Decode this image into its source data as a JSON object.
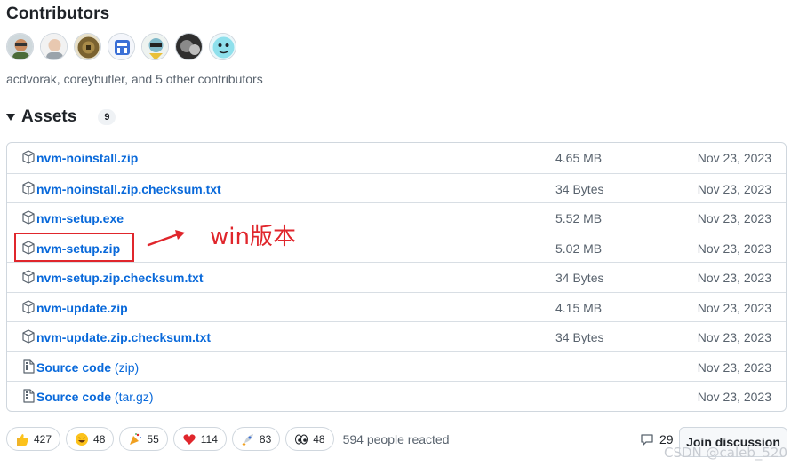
{
  "contributors": {
    "title": "Contributors",
    "text": "acdvorak, coreybutler, and 5 other contributors",
    "avatars": [
      {
        "name": "avatar-1",
        "color": "#8a6a4f"
      },
      {
        "name": "avatar-2",
        "color": "#e8e8e8"
      },
      {
        "name": "avatar-3",
        "color": "#6b5a2e"
      },
      {
        "name": "avatar-4",
        "color": "#3a6fd6"
      },
      {
        "name": "avatar-5",
        "color": "#7fb8c9"
      },
      {
        "name": "avatar-6",
        "color": "#555555"
      },
      {
        "name": "avatar-7",
        "color": "#5fd0e0"
      }
    ]
  },
  "assets": {
    "title": "Assets",
    "count": "9",
    "files": [
      {
        "name": "nvm-noinstall.zip",
        "suffix": "",
        "size": "4.65 MB",
        "date": "Nov 23, 2023",
        "icon": "package-icon"
      },
      {
        "name": "nvm-noinstall.zip.checksum.txt",
        "suffix": "",
        "size": "34 Bytes",
        "date": "Nov 23, 2023",
        "icon": "package-icon"
      },
      {
        "name": "nvm-setup.exe",
        "suffix": "",
        "size": "5.52 MB",
        "date": "Nov 23, 2023",
        "icon": "package-icon"
      },
      {
        "name": "nvm-setup.zip",
        "suffix": "",
        "size": "5.02 MB",
        "date": "Nov 23, 2023",
        "icon": "package-icon"
      },
      {
        "name": "nvm-setup.zip.checksum.txt",
        "suffix": "",
        "size": "34 Bytes",
        "date": "Nov 23, 2023",
        "icon": "package-icon"
      },
      {
        "name": "nvm-update.zip",
        "suffix": "",
        "size": "4.15 MB",
        "date": "Nov 23, 2023",
        "icon": "package-icon"
      },
      {
        "name": "nvm-update.zip.checksum.txt",
        "suffix": "",
        "size": "34 Bytes",
        "date": "Nov 23, 2023",
        "icon": "package-icon"
      },
      {
        "name": "Source code",
        "suffix": " (zip)",
        "size": "",
        "date": "Nov 23, 2023",
        "icon": "file-zip-icon"
      },
      {
        "name": "Source code",
        "suffix": " (tar.gz)",
        "size": "",
        "date": "Nov 23, 2023",
        "icon": "file-zip-icon"
      }
    ]
  },
  "annotation": {
    "text": "win版本",
    "color": "#e0262c"
  },
  "reactions": {
    "items": [
      {
        "emoji": "thumbs-up-icon",
        "count": "427"
      },
      {
        "emoji": "laugh-icon",
        "count": "48"
      },
      {
        "emoji": "hooray-icon",
        "count": "55"
      },
      {
        "emoji": "heart-icon",
        "count": "114"
      },
      {
        "emoji": "rocket-icon",
        "count": "83"
      },
      {
        "emoji": "eyes-icon",
        "count": "48"
      }
    ],
    "summary": "594 people reacted"
  },
  "discussion": {
    "comment_count": "29",
    "join_label": "Join discussion"
  },
  "watermark": "CSDN @caleb_520",
  "colors": {
    "link": "#0969da",
    "muted": "#59636e",
    "border": "#d0d7de"
  }
}
